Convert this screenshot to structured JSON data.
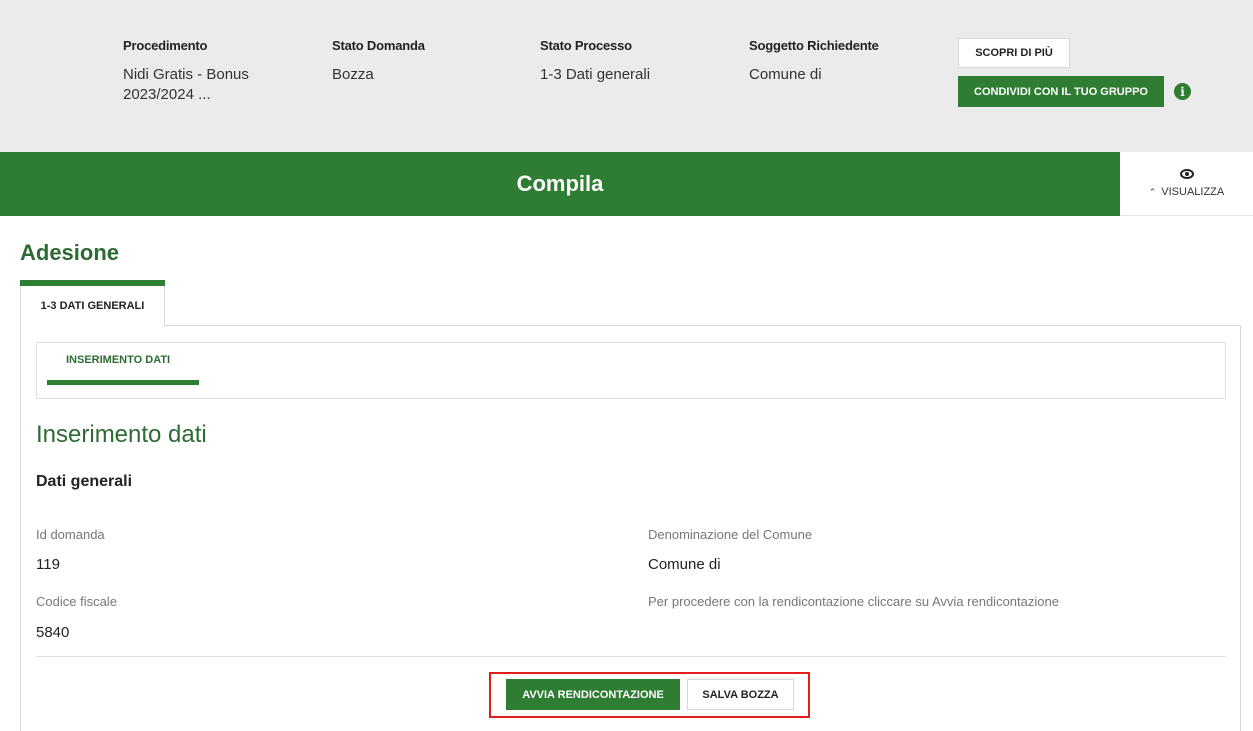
{
  "header": {
    "procedimento": {
      "label": "Procedimento",
      "value": "Nidi Gratis - Bonus 2023/2024 ..."
    },
    "stato_domanda": {
      "label": "Stato Domanda",
      "value": "Bozza"
    },
    "stato_processo": {
      "label": "Stato Processo",
      "value": "1-3 Dati generali"
    },
    "soggetto": {
      "label": "Soggetto Richiedente",
      "value": "Comune di"
    },
    "scopri_label": "SCOPRI DI PIÙ",
    "condividi_label": "CONDIVIDI CON IL TUO GRUPPO",
    "info_icon": "info-icon"
  },
  "bar": {
    "title": "Compila",
    "visualizza_label": "VISUALIZZA"
  },
  "main": {
    "page_title": "Adesione",
    "tab_label": "1-3 DATI GENERALI",
    "step_label": "INSERIMENTO DATI",
    "section_title": "Inserimento dati",
    "subsection_title": "Dati generali",
    "fields": {
      "id_domanda": {
        "label": "Id domanda",
        "value": "119"
      },
      "denominazione": {
        "label": "Denominazione del Comune",
        "value": "Comune di"
      },
      "codice_fiscale": {
        "label": "Codice fiscale",
        "value": "5840"
      },
      "note": "Per procedere con la rendicontazione cliccare su Avvia rendicontazione"
    },
    "avvia_label": "AVVIA RENDICONTAZIONE",
    "salva_label": "SALVA BOZZA"
  },
  "colors": {
    "primary_green": "#2e7d32",
    "title_green": "#2e6b33",
    "highlight_red": "#e01e1e",
    "strip_gray": "#ebebeb"
  }
}
